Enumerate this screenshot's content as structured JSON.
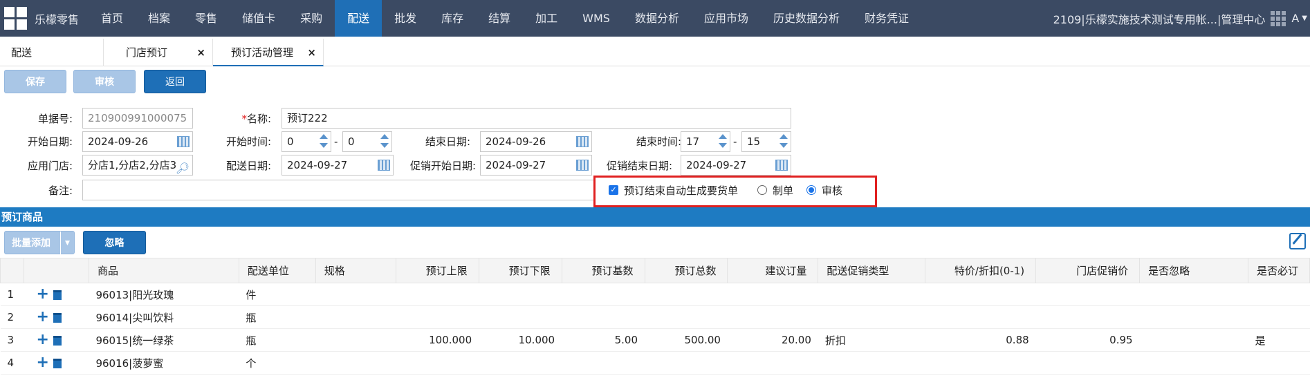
{
  "topnav": {
    "brand": "乐檬零售",
    "items": [
      "首页",
      "档案",
      "零售",
      "储值卡",
      "采购",
      "配送",
      "批发",
      "库存",
      "结算",
      "加工",
      "WMS",
      "数据分析",
      "应用市场",
      "历史数据分析",
      "财务凭证"
    ],
    "active_index": 5,
    "account": "2109|乐檬实施技术测试专用帐...|管理中心",
    "user_initial": "A"
  },
  "tabs": [
    {
      "label": "配送",
      "closable": false
    },
    {
      "label": "门店预订",
      "closable": true
    },
    {
      "label": "预订活动管理",
      "closable": true
    }
  ],
  "toolbar": {
    "save": "保存",
    "audit": "审核",
    "back": "返回"
  },
  "form": {
    "doc_no_label": "单据号:",
    "doc_no": "210900991000075",
    "name_label": "名称:",
    "name_required": "*",
    "name": "预订222",
    "start_date_label": "开始日期:",
    "start_date": "2024-09-26",
    "start_time_label": "开始时间:",
    "start_hour": "0",
    "start_min": "0",
    "end_date_label": "结束日期:",
    "end_date": "2024-09-26",
    "end_time_label": "结束时间:",
    "end_hour": "17",
    "end_min": "15",
    "stores_label": "应用门店:",
    "stores": "分店1,分店2,分店3",
    "delivery_date_label": "配送日期:",
    "delivery_date": "2024-09-27",
    "promo_start_label": "促销开始日期:",
    "promo_start": "2024-09-27",
    "promo_end_label": "促销结束日期:",
    "promo_end": "2024-09-27",
    "remark_label": "备注:",
    "remark": "",
    "auto_gen_label": "预订结束自动生成要货单",
    "auto_gen_checked": true,
    "radio_make": "制单",
    "radio_audit": "审核",
    "radio_selected": "审核",
    "dash": "-"
  },
  "section": {
    "title": "预订商品",
    "batch_add": "批量添加",
    "ignore": "忽略"
  },
  "table": {
    "columns": [
      "",
      "",
      "商品",
      "配送单位",
      "规格",
      "预订上限",
      "预订下限",
      "预订基数",
      "预订总数",
      "建议订量",
      "配送促销类型",
      "特价/折扣(0-1)",
      "门店促销价",
      "是否忽略",
      "是否必订"
    ],
    "rows": [
      {
        "no": "1",
        "product": "96013|阳光玫瑰",
        "unit": "件",
        "spec": "",
        "max": "",
        "min": "",
        "base": "",
        "total": "",
        "suggest": "",
        "promo_type": "",
        "price": "",
        "store_price": "",
        "ignored": "",
        "required": ""
      },
      {
        "no": "2",
        "product": "96014|尖叫饮料",
        "unit": "瓶",
        "spec": "",
        "max": "",
        "min": "",
        "base": "",
        "total": "",
        "suggest": "",
        "promo_type": "",
        "price": "",
        "store_price": "",
        "ignored": "",
        "required": ""
      },
      {
        "no": "3",
        "product": "96015|统一绿茶",
        "unit": "瓶",
        "spec": "",
        "max": "100.000",
        "min": "10.000",
        "base": "5.00",
        "total": "500.00",
        "suggest": "20.00",
        "promo_type": "折扣",
        "price": "0.88",
        "store_price": "0.95",
        "ignored": "",
        "required": "是"
      },
      {
        "no": "4",
        "product": "96016|菠萝蜜",
        "unit": "个",
        "spec": "",
        "max": "",
        "min": "",
        "base": "",
        "total": "",
        "suggest": "",
        "promo_type": "",
        "price": "",
        "store_price": "",
        "ignored": "",
        "required": ""
      }
    ]
  }
}
